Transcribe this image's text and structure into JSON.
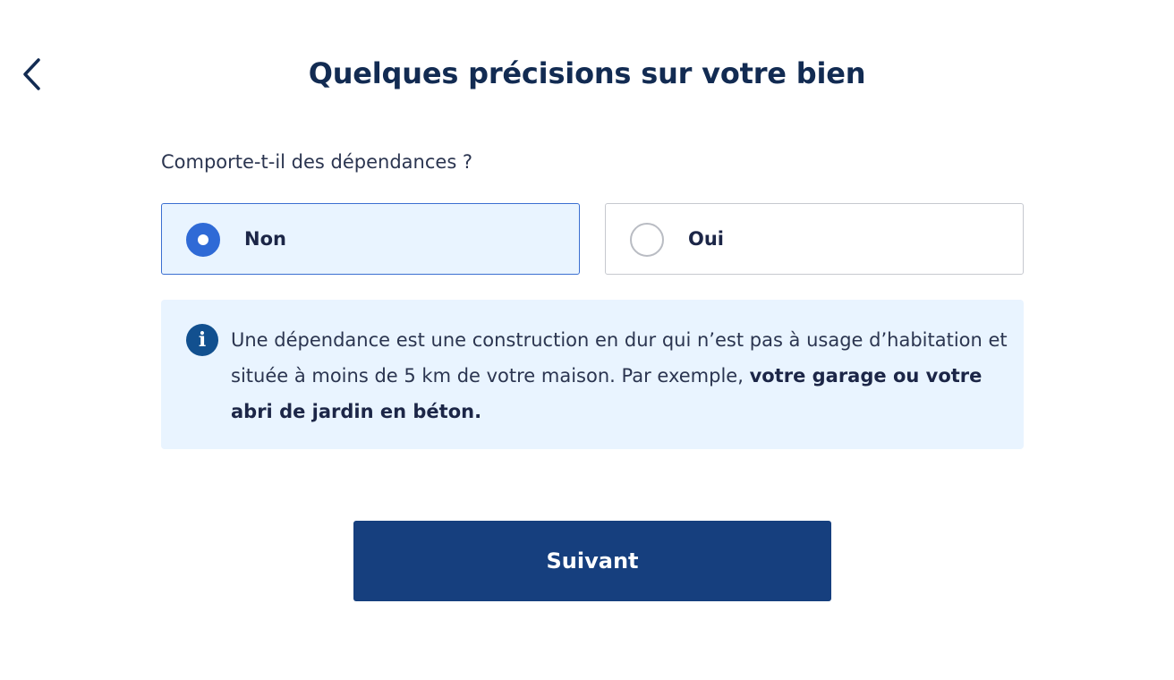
{
  "header": {
    "back_icon": "chevron-left-icon",
    "title": "Quelques précisions sur votre bien"
  },
  "question": {
    "label": "Comporte-t-il des dépendances ?",
    "options": [
      {
        "label": "Non",
        "selected": true
      },
      {
        "label": "Oui",
        "selected": false
      }
    ]
  },
  "info": {
    "icon": "info-icon",
    "icon_glyph": "i",
    "text_regular": "Une dépendance est une construction en dur qui n’est pas à usage d’habitation et située à moins de 5 km de votre maison. Par exemple, ",
    "text_bold": "votre garage ou votre abri de jardin en béton."
  },
  "actions": {
    "next_label": "Suivant"
  },
  "colors": {
    "title": "#122b52",
    "selected_border": "#3b6fd1",
    "selected_background": "#e9f4ff",
    "radio_checked": "#2f6ad6",
    "info_icon": "#12508f",
    "primary_button": "#163f7e"
  }
}
